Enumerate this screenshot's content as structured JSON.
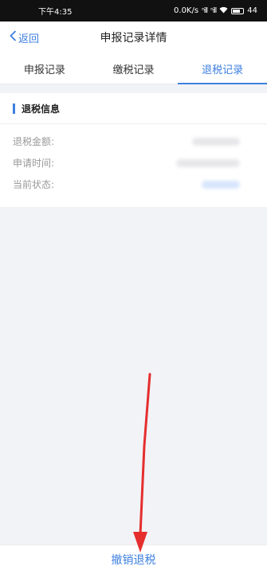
{
  "status_bar": {
    "time": "下午4:35",
    "network_speed": "0.0K/s",
    "signal1": "ⁿill",
    "signal2": "ⁿill",
    "battery": "44"
  },
  "nav": {
    "back_label": "返回",
    "title": "申报记录详情"
  },
  "tabs": [
    {
      "label": "申报记录",
      "active": false
    },
    {
      "label": "缴税记录",
      "active": false
    },
    {
      "label": "退税记录",
      "active": true
    }
  ],
  "refund_info": {
    "section_title": "退税信息",
    "fields": [
      {
        "label": "退税金额:"
      },
      {
        "label": "申请时间:"
      },
      {
        "label": "当前状态:"
      }
    ]
  },
  "bottom": {
    "cancel_label": "撤销退税"
  },
  "colors": {
    "accent": "#3d7fe0",
    "background": "#f2f3f7",
    "annotation_arrow": "#e52e2e"
  }
}
